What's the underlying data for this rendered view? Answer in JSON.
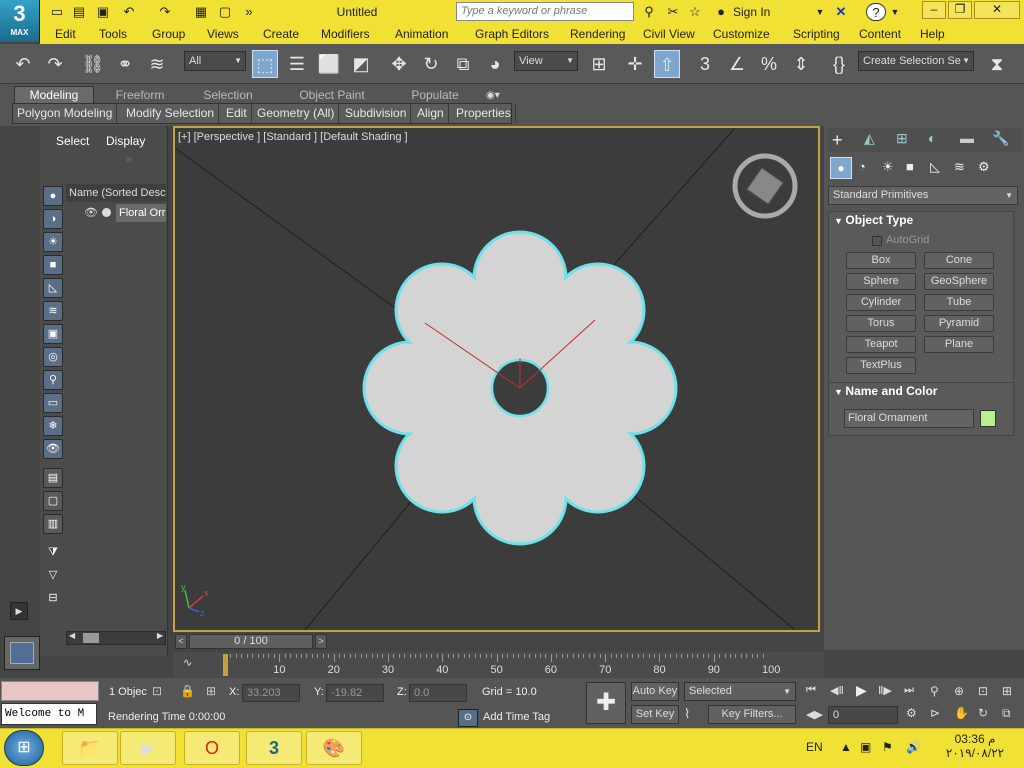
{
  "app": {
    "logo_number": "3",
    "logo_text": "MAX",
    "window_title": "Untitled",
    "search_placeholder": "Type a keyword or phrase",
    "sign_in": "Sign In",
    "help_icon": "?"
  },
  "menu": [
    "Edit",
    "Tools",
    "Group",
    "Views",
    "Create",
    "Modifiers",
    "Animation",
    "Graph Editors",
    "Rendering",
    "Civil View",
    "Customize",
    "Scripting",
    "Content",
    "Help"
  ],
  "toolbar": {
    "filter_value": "All",
    "view_value": "View",
    "selection_set_value": "Create Selection Se"
  },
  "ribbon": {
    "tabs": [
      "Modeling",
      "Freeform",
      "Selection",
      "Object Paint",
      "Populate"
    ],
    "subtabs": [
      "Polygon Modeling",
      "Modify Selection",
      "Edit",
      "Geometry (All)",
      "Subdivision",
      "Align",
      "Properties"
    ]
  },
  "scene_explorer": {
    "select_label": "Select",
    "display_label": "Display",
    "column_header": "Name (Sorted Desce",
    "item": "Floral Orr"
  },
  "viewport": {
    "label": "[+] [Perspective ] [Standard ] [Default Shading ]",
    "axis_x": "x",
    "axis_y": "y",
    "axis_z": "z",
    "object_color": "#6ce2ea"
  },
  "command_panel": {
    "category": "Standard Primitives",
    "object_type_title": "Object Type",
    "autogrid": "AutoGrid",
    "buttons": [
      "Box",
      "Cone",
      "Sphere",
      "GeoSphere",
      "Cylinder",
      "Tube",
      "Torus",
      "Pyramid",
      "Teapot",
      "Plane",
      "TextPlus"
    ],
    "name_color_title": "Name and Color",
    "object_name": "Floral Ornament",
    "color_swatch": "#b8f08c"
  },
  "timeline": {
    "frame": "0 / 100",
    "ticks": [
      "0",
      "10",
      "20",
      "30",
      "40",
      "50",
      "60",
      "70",
      "80",
      "90",
      "100"
    ]
  },
  "status": {
    "selected_count": "1 Objec",
    "x_label": "X:",
    "x_value": "33.203",
    "y_label": "Y:",
    "y_value": "-19.82",
    "z_label": "Z:",
    "z_value": "0.0",
    "grid": "Grid = 10.0",
    "rendering_time": "Rendering Time  0:00:00",
    "add_time_tag": "Add Time Tag",
    "auto_key": "Auto Key",
    "set_key": "Set Key",
    "key_mode": "Selected",
    "key_filters": "Key Filters...",
    "frame_field": "0",
    "maxscript": "Welcome to M"
  },
  "taskbar": {
    "lang": "EN",
    "time": "03:36 م",
    "date": "٢٠١٩/٠٨/٢٢"
  }
}
